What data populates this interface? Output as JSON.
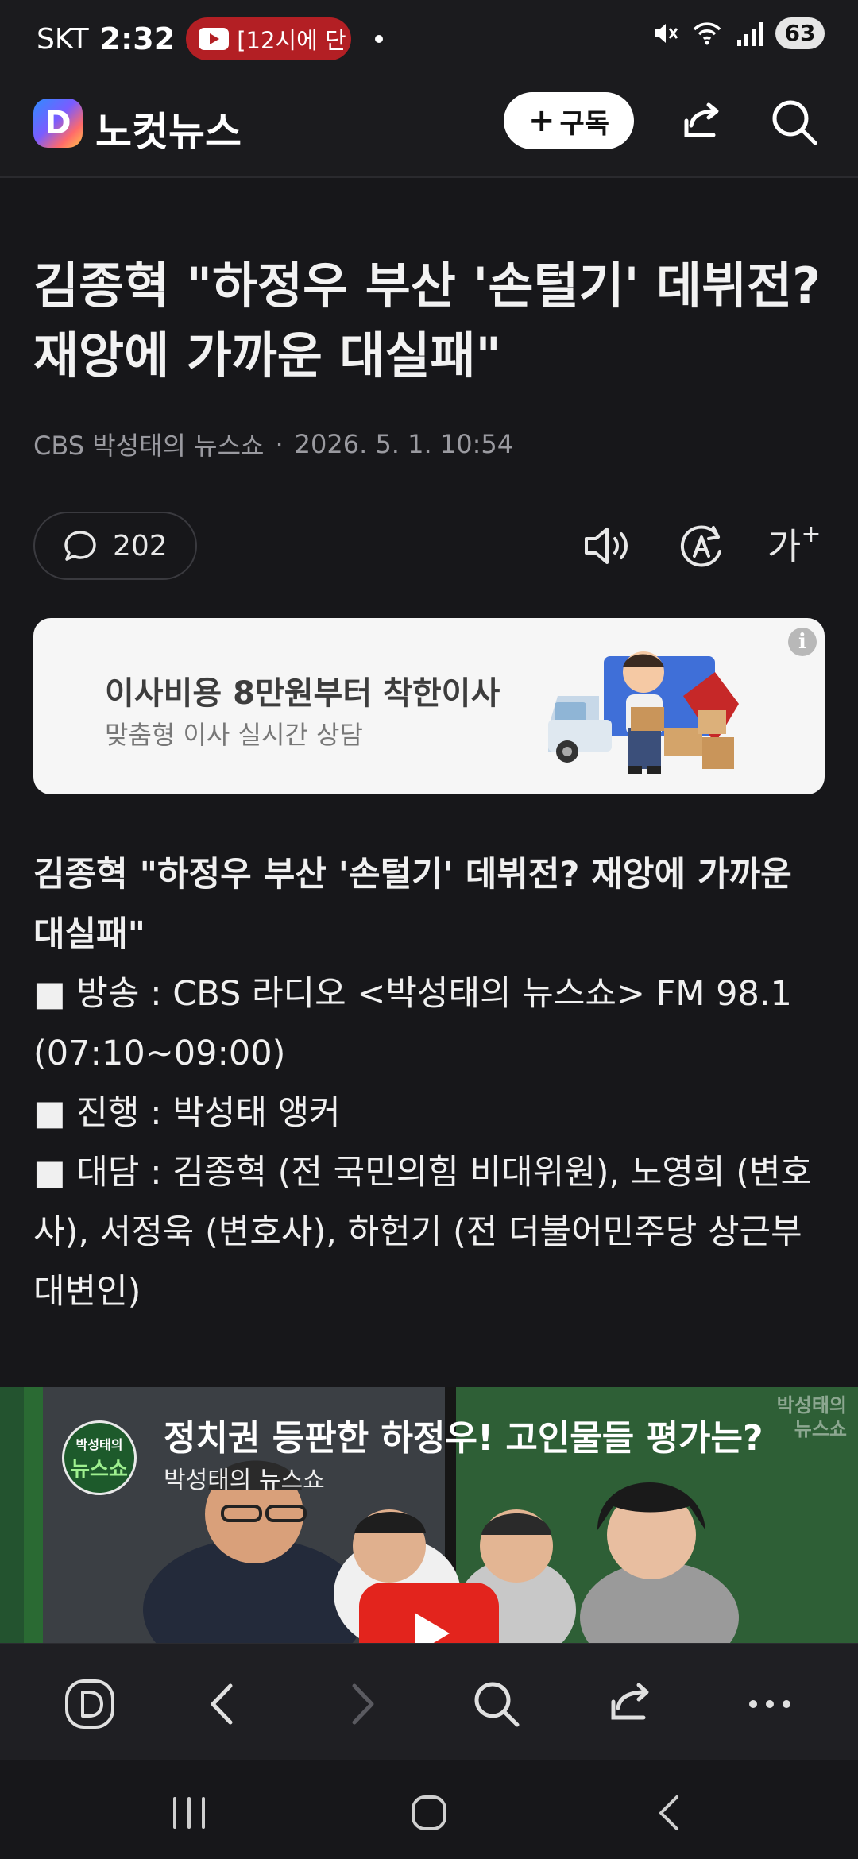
{
  "status_bar": {
    "carrier": "SKT",
    "time": "2:32",
    "notification_text": "[12시에 단",
    "battery": "63"
  },
  "header": {
    "logo_letter": "D",
    "app_name": "노컷뉴스",
    "subscribe_plus": "+",
    "subscribe_label": "구독"
  },
  "article": {
    "headline": "김종혁 \"하정우 부산 '손털기' 데뷔전? 재앙에 가까운 대실패\"",
    "source": "CBS 박성태의 뉴스쇼",
    "separator": "·",
    "date": "2026. 5. 1. 10:54",
    "comment_count": "202",
    "font_size_label": "가",
    "font_size_sup": "+"
  },
  "ad": {
    "title": "이사비용 8만원부터 착한이사",
    "subtitle": "맞춤형 이사 실시간 상담",
    "info": "i"
  },
  "body": {
    "subheading": "김종혁 \"하정우 부산 '손털기' 데뷔전? 재앙에 가까운 대실패\"",
    "line1": "■ 방송 : CBS 라디오 <박성태의 뉴스쇼> FM 98.1 (07:10~09:00)",
    "line2": "■ 진행 : 박성태 앵커",
    "line3": "■ 대담 : 김종혁 (전 국민의힘 비대위원), 노영희 (변호사), 서정욱 (변호사), 하헌기 (전 더불어민주당 상근부대변인)"
  },
  "video": {
    "title": "정치권 등판한 하정우! 고인물들 평가는?",
    "channel": "박성태의 뉴스쇼",
    "avatar_line1": "박성태의",
    "avatar_line2": "뉴스쇼",
    "watermark_line1": "박성태의",
    "watermark_line2": "뉴스쇼"
  },
  "icons": {
    "header": [
      "share-icon",
      "search-icon"
    ],
    "article_tools": [
      "comment-icon",
      "speaker-icon",
      "translate-icon",
      "font-size-icon"
    ],
    "toolbar": [
      "home-icon",
      "back-icon",
      "forward-icon",
      "search-icon",
      "share-icon",
      "more-icon"
    ],
    "android_nav": [
      "recents-icon",
      "home-icon",
      "back-icon"
    ]
  }
}
